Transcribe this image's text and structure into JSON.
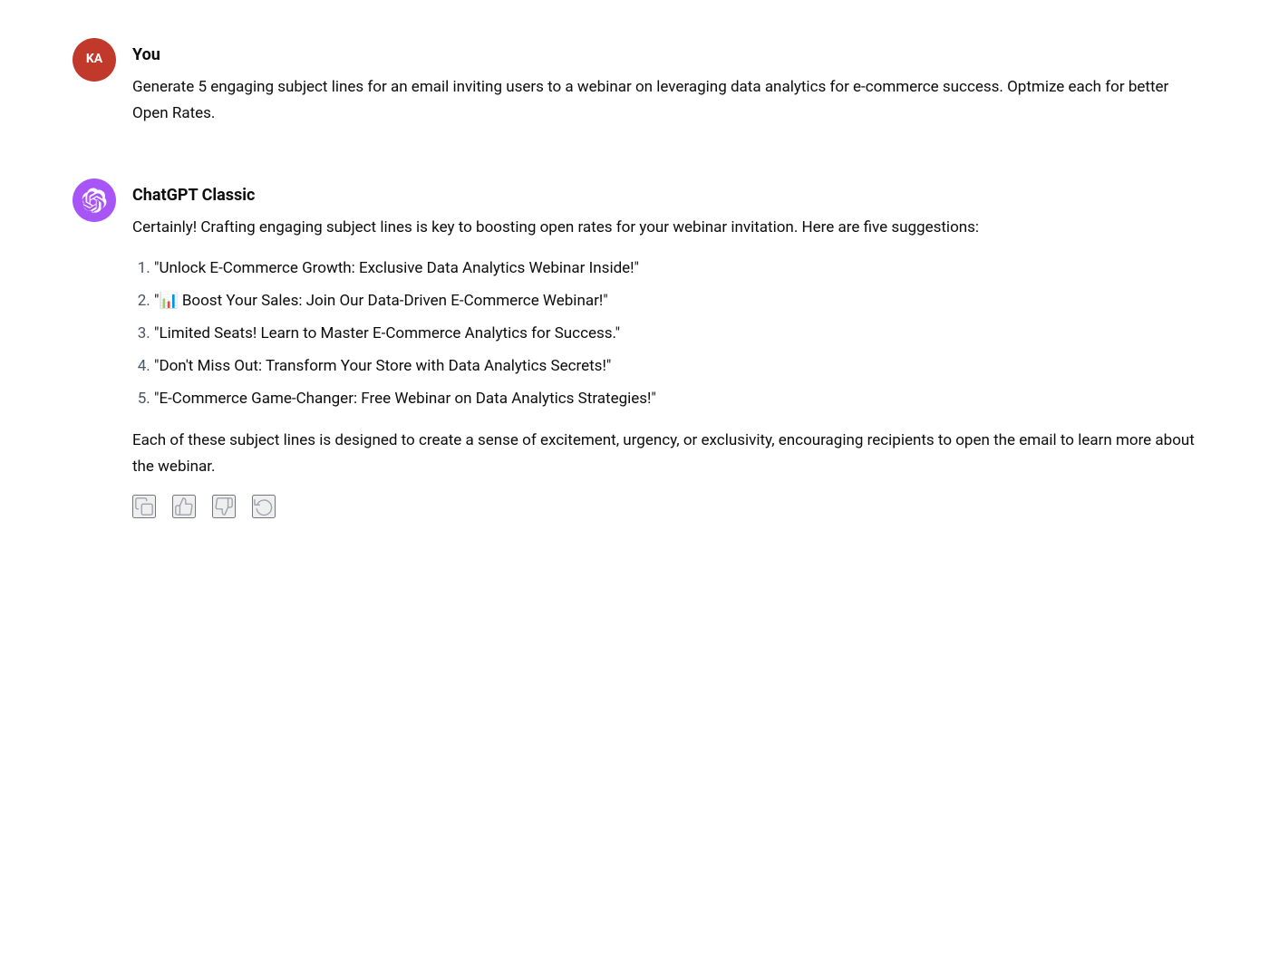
{
  "user_message": {
    "avatar_initials": "KA",
    "sender_label": "You",
    "text": "Generate 5 engaging subject lines for an email inviting users to a webinar on leveraging data analytics for e-commerce success. Optmize each for better Open Rates."
  },
  "assistant_message": {
    "sender_label": "ChatGPT Classic",
    "intro": "Certainly! Crafting engaging subject lines is key to boosting open rates for your webinar invitation. Here are five suggestions:",
    "list_items": [
      {
        "number": "1.",
        "text": "\"Unlock E-Commerce Growth: Exclusive Data Analytics Webinar Inside!\""
      },
      {
        "number": "2.",
        "text": "\"📊 Boost Your Sales: Join Our Data-Driven E-Commerce Webinar!\""
      },
      {
        "number": "3.",
        "text": "\"Limited Seats! Learn to Master E-Commerce Analytics for Success.\""
      },
      {
        "number": "4.",
        "text": "\"Don't Miss Out: Transform Your Store with Data Analytics Secrets!\""
      },
      {
        "number": "5.",
        "text": "\"E-Commerce Game-Changer: Free Webinar on Data Analytics Strategies!\""
      }
    ],
    "outro": "Each of these subject lines is designed to create a sense of excitement, urgency, or exclusivity, encouraging recipients to open the email to learn more about the webinar."
  },
  "icons": {
    "copy": "copy-icon",
    "thumbs_up": "thumbs-up-icon",
    "thumbs_down": "thumbs-down-icon",
    "refresh": "refresh-icon"
  }
}
